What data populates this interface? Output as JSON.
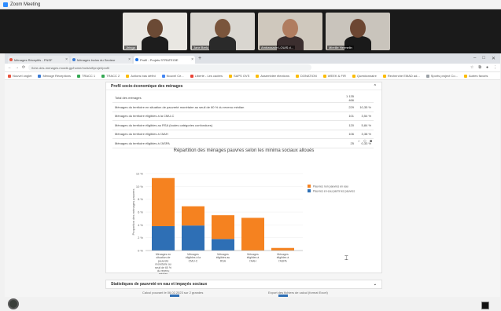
{
  "zoom": {
    "title": "Zoom Meeting"
  },
  "participants": [
    {
      "name": "Jiringa",
      "bg": "#e9e7e2",
      "skin": "#6b4a35",
      "shirt": "#1d1d1d"
    },
    {
      "name": "Jane Brelu",
      "bg": "#d9d6d0",
      "skin": "#7a553c",
      "shirt": "#2a2a2a"
    },
    {
      "name": "Ambassade LOUIS d...",
      "bg": "#cfc8bd",
      "skin": "#b07d60",
      "shirt": "#3b2e2e"
    },
    {
      "name": "Mireille Hermelin",
      "bg": "#c9c4bc",
      "skin": "#6c4632",
      "shirt": "#1a1a1a"
    }
  ],
  "browser": {
    "tabs": [
      {
        "title": "Ménages Réceptifs - PNSF",
        "color": "#e8543f"
      },
      {
        "title": "Ménages Inclus du Secteur",
        "color": "#3a7bd5"
      },
      {
        "title": "Profil - Projets STRATEGIE",
        "color": "#1a73e8"
      }
    ],
    "url": "fiche-des-menages.mowik.gp/home/mcts/sif/projet/profil",
    "bookmarks": [
      {
        "label": "Nouvel onglet",
        "color": "#e8543f"
      },
      {
        "label": "Ménage Réceptions",
        "color": "#3a7bd5"
      },
      {
        "label": "TRACC 1",
        "color": "#34a853"
      },
      {
        "label": "TRACC 2",
        "color": "#34a853"
      },
      {
        "label": "Actions bas défini",
        "color": "#fbbc05"
      },
      {
        "label": "Nouvel Ce...",
        "color": "#4285f4"
      },
      {
        "label": "Liberté - Les cadres",
        "color": "#ea4335"
      },
      {
        "label": "SAPS OVS",
        "color": "#fbbc05"
      },
      {
        "label": "Assemblée élections",
        "color": "#fbbc05"
      },
      {
        "label": "DONATION",
        "color": "#fbbc05"
      },
      {
        "label": "WEEK & FIR",
        "color": "#fbbc05"
      },
      {
        "label": "Questionnaire",
        "color": "#fbbc05"
      },
      {
        "label": "Recherche EMAD ad...",
        "color": "#fbbc05"
      },
      {
        "label": "Sports project Co...",
        "color": "#9aa0a6"
      },
      {
        "label": "Autres favoris",
        "color": "#fbbc05"
      }
    ]
  },
  "card1": {
    "title": "Profil socio-économique des ménages",
    "rows": [
      {
        "label": "Total des ménages",
        "count": "1 135 466",
        "pct": ""
      },
      {
        "label": "Ménages du territoire en situation de pauvreté monétaire au seuil de 60 % du revenu médian",
        "count": "229",
        "pct": "10,35 %"
      },
      {
        "label": "Ménages du territoire éligibles à la CMU-C",
        "count": "101",
        "pct": "3,54 %"
      },
      {
        "label": "Ménages du territoire éligibles au RSA (toutes catégories confondues)",
        "count": "120",
        "pct": "5,84 %"
      },
      {
        "label": "Ménages du territoire éligibles à l'AAH",
        "count": "106",
        "pct": "3,38 %"
      },
      {
        "label": "Ménages du territoire éligibles à l'ASPA",
        "count": "25",
        "pct": "0,33 %"
      }
    ]
  },
  "chart_data": {
    "type": "bar",
    "title": "Répartition des ménages pauvres selon les minima sociaux alloués",
    "ylabel": "Proportion des ménages pauvres",
    "ylim": [
      0,
      12
    ],
    "yticks": [
      "12 %",
      "10 %",
      "8 %",
      "6 %",
      "4 %",
      "2 %",
      "0 %"
    ],
    "categories": [
      "Ménages en situation de pauvreté monétaire au seuil de 60 % du revenu médian",
      "Ménages éligibles à la CMU-C",
      "Ménages éligibles au RSA",
      "Ménages éligibles à l'AAH",
      "Ménages éligibles à l'ASPA"
    ],
    "series": [
      {
        "name": "Pauvres non pauvres en eau",
        "color": "#f58220",
        "values": [
          7.5,
          3.0,
          3.7,
          5.1,
          0.4
        ]
      },
      {
        "name": "Pauvres en eau parmi les pauvres",
        "color": "#2e6fb5",
        "values": [
          3.8,
          3.9,
          1.8,
          0,
          0
        ]
      }
    ],
    "legend": "top-right"
  },
  "card2": {
    "title": "Statistiques de pauvreté en eau et impayés sociaux"
  },
  "footer_left": "Calcul pouvant le 06.02.2023 sur 2 grandes",
  "footer_right": "Export des fichiers de calcul (format Excel)"
}
